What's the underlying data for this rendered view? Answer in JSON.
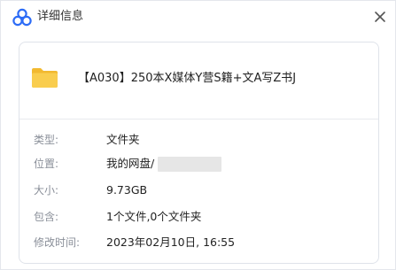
{
  "window": {
    "title": "详细信息",
    "app_icon": "cloud-icon",
    "close_icon": "close-icon"
  },
  "file": {
    "icon": "folder-icon",
    "name": "【A030】250本X媒体Y营S籍+文A写Z书J"
  },
  "details": {
    "type": {
      "label": "类型:",
      "value": "文件夹"
    },
    "location": {
      "label": "位置:",
      "value": "我的网盘/"
    },
    "size": {
      "label": "大小:",
      "value": "9.73GB"
    },
    "contains": {
      "label": "包含:",
      "value": "1个文件,0个文件夹"
    },
    "modified": {
      "label": "修改时间:",
      "value": "2023年02月10日, 16:55"
    }
  },
  "colors": {
    "accent_blue": "#2d6cf6",
    "folder_yellow": "#f7c94a",
    "label_gray": "#8a8f99"
  }
}
